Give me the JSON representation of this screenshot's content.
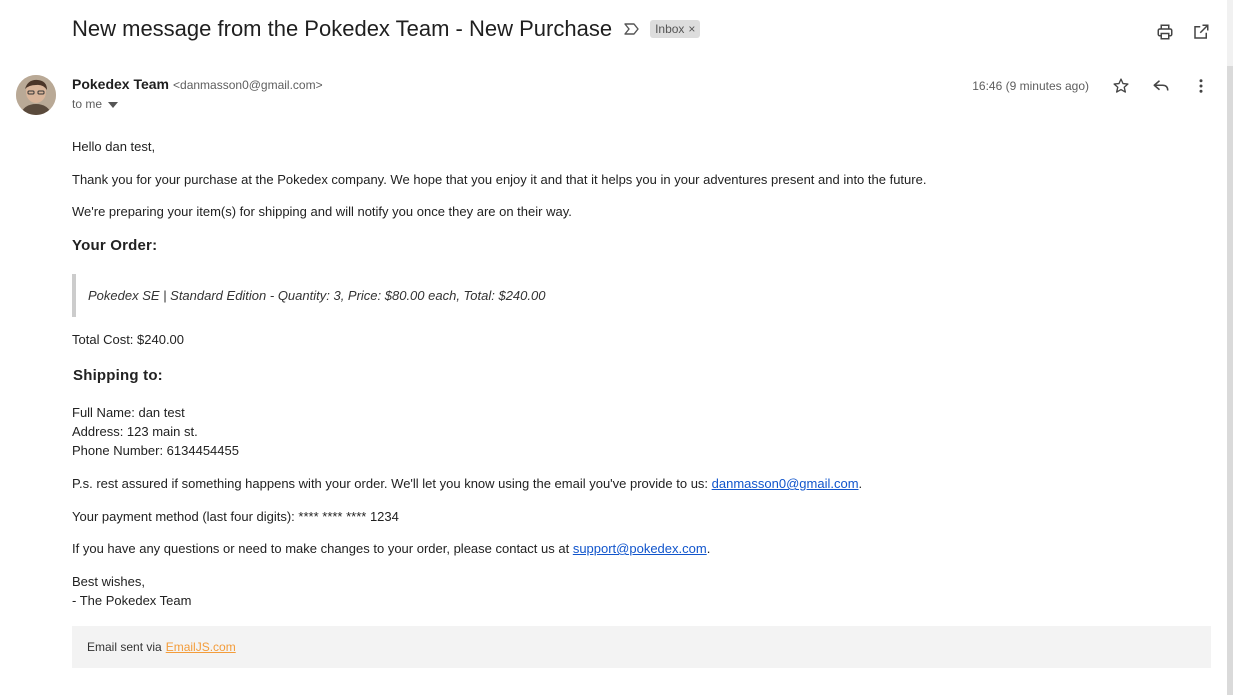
{
  "email": {
    "subject": "New message from the Pokedex Team - New Purchase",
    "label": "Inbox",
    "label_close": "×",
    "sender_name": "Pokedex Team",
    "sender_email": "<danmasson0@gmail.com>",
    "to": "to me",
    "timestamp": "16:46 (9 minutes ago)"
  },
  "body": {
    "greeting": "Hello dan test,",
    "thanks": "Thank you for your purchase at the Pokedex company. We hope that you enjoy it and that it helps you in your adventures present and into the future.",
    "preparing": "We're preparing your item(s) for shipping and will notify you once they are on their way.",
    "order_heading": "Your Order:",
    "order_line": "Pokedex SE | Standard Edition - Quantity: 3, Price: $80.00 each, Total: $240.00",
    "total_cost": "Total Cost: $240.00",
    "shipping_heading": "Shipping to:",
    "full_name": "Full Name: dan test",
    "address": "Address: 123 main st.",
    "phone": "Phone Number: 6134454455",
    "ps_text": "P.s. rest assured if something happens with your order. We'll let you know using the email you've provide to us: ",
    "ps_email": "danmasson0@gmail.com",
    "ps_end": ".",
    "payment": "Your payment method (last four digits): **** **** **** 1234",
    "questions_text": "If you have any questions or need to make changes to your order, please contact us at ",
    "support_email": "support@pokedex.com",
    "questions_end": ".",
    "sign_1": "Best wishes,",
    "sign_2": "- The Pokedex Team"
  },
  "footer": {
    "text": "Email sent via",
    "link": "EmailJS.com"
  },
  "icons": {
    "importance": "importance-marker-icon",
    "print": "print-icon",
    "open_new_window": "open-in-new-window-icon",
    "star": "star-icon",
    "reply": "reply-icon",
    "more": "more-vert-icon",
    "dropdown": "caret-down-icon"
  },
  "colors": {
    "link": "#1155cc",
    "footer_link": "#f39c3a",
    "label_bg": "#dddddd",
    "footer_bg": "#f3f3f3"
  }
}
